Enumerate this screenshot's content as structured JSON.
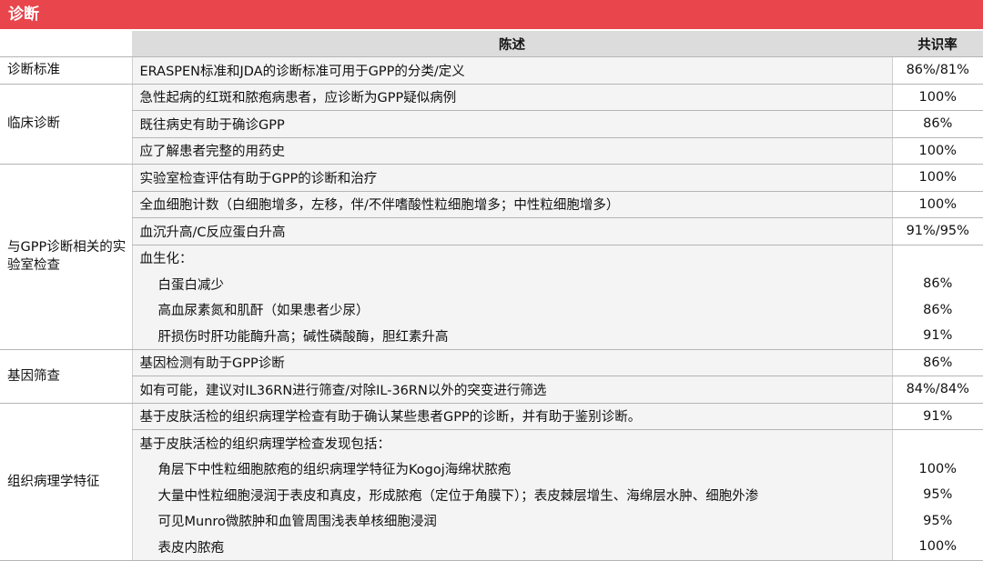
{
  "title": "诊断",
  "headers": {
    "category": "",
    "statement": "陈述",
    "rate": "共识率"
  },
  "groups": [
    {
      "name": "诊断标准",
      "rows": [
        {
          "statement": "ERASPEN标准和JDA的诊断标准可用于GPP的分类/定义",
          "rate": "86%/81%"
        }
      ]
    },
    {
      "name": "临床诊断",
      "rows": [
        {
          "statement": "急性起病的红斑和脓疱病患者，应诊断为GPP疑似病例",
          "rate": "100%"
        },
        {
          "statement": "既往病史有助于确诊GPP",
          "rate": "86%"
        },
        {
          "statement": "应了解患者完整的用药史",
          "rate": "100%"
        }
      ]
    },
    {
      "name": "与GPP诊断相关的实验室检查",
      "rows": [
        {
          "statement": "实验室检查评估有助于GPP的诊断和治疗",
          "rate": "100%"
        },
        {
          "statement": "全血细胞计数（白细胞增多，左移，伴/不伴嗜酸性粒细胞增多；中性粒细胞增多）",
          "rate": "100%"
        },
        {
          "statement": "血沉升高/C反应蛋白升高",
          "rate": "91%/95%"
        },
        {
          "statement": "血生化：",
          "rate": ""
        },
        {
          "statement": "白蛋白减少",
          "rate": "86%"
        },
        {
          "statement": "高血尿素氮和肌酐（如果患者少尿）",
          "rate": "86%"
        },
        {
          "statement": "肝损伤时肝功能酶升高；碱性磷酸酶，胆红素升高",
          "rate": "91%"
        }
      ]
    },
    {
      "name": "基因筛查",
      "rows": [
        {
          "statement": "基因检测有助于GPP诊断",
          "rate": "86%"
        },
        {
          "statement": "如有可能，建议对IL36RN进行筛查/对除IL-36RN以外的突变进行筛选",
          "rate": "84%/84%"
        }
      ]
    },
    {
      "name": "组织病理学特征",
      "rows": [
        {
          "statement": "基于皮肤活检的组织病理学检查有助于确认某些患者GPP的诊断，并有助于鉴别诊断。",
          "rate": "91%"
        },
        {
          "statement": "基于皮肤活检的组织病理学检查发现包括：",
          "rate": ""
        },
        {
          "statement": "角层下中性粒细胞脓疱的组织病理学特征为Kogoj海绵状脓疱",
          "rate": "100%"
        },
        {
          "statement": "大量中性粒细胞浸润于表皮和真皮，形成脓疱（定位于角膜下）；表皮棘层增生、海绵层水肿、细胞外渗",
          "rate": "95%"
        },
        {
          "statement": "可见Munro微脓肿和血管周围浅表单核细胞浸润",
          "rate": "95%"
        },
        {
          "statement": "表皮内脓疱",
          "rate": "100%"
        }
      ]
    }
  ]
}
